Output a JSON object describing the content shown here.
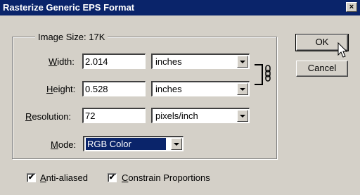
{
  "window": {
    "title": "Rasterize Generic EPS Format",
    "close_glyph": "×"
  },
  "group": {
    "title": "Image Size: 17K"
  },
  "fields": {
    "width": {
      "label_u": "W",
      "label_rest": "idth:",
      "value": "2.014",
      "unit": "inches"
    },
    "height": {
      "label_u": "H",
      "label_rest": "eight:",
      "value": "0.528",
      "unit": "inches"
    },
    "resolution": {
      "label_u": "R",
      "label_rest": "esolution:",
      "value": "72",
      "unit": "pixels/inch"
    },
    "mode": {
      "label_u": "M",
      "label_rest": "ode:",
      "value": "RGB Color"
    }
  },
  "buttons": {
    "ok": "OK",
    "cancel": "Cancel"
  },
  "options": {
    "anti_aliased": {
      "label_u": "A",
      "label_rest": "nti-aliased",
      "checked": true,
      "mark": "✔"
    },
    "constrain": {
      "label_u": "C",
      "label_rest": "onstrain Proportions",
      "checked": true,
      "mark": "✔"
    }
  },
  "icons": {
    "link": "chain-link-icon",
    "cursor": "mouse-pointer-icon"
  }
}
